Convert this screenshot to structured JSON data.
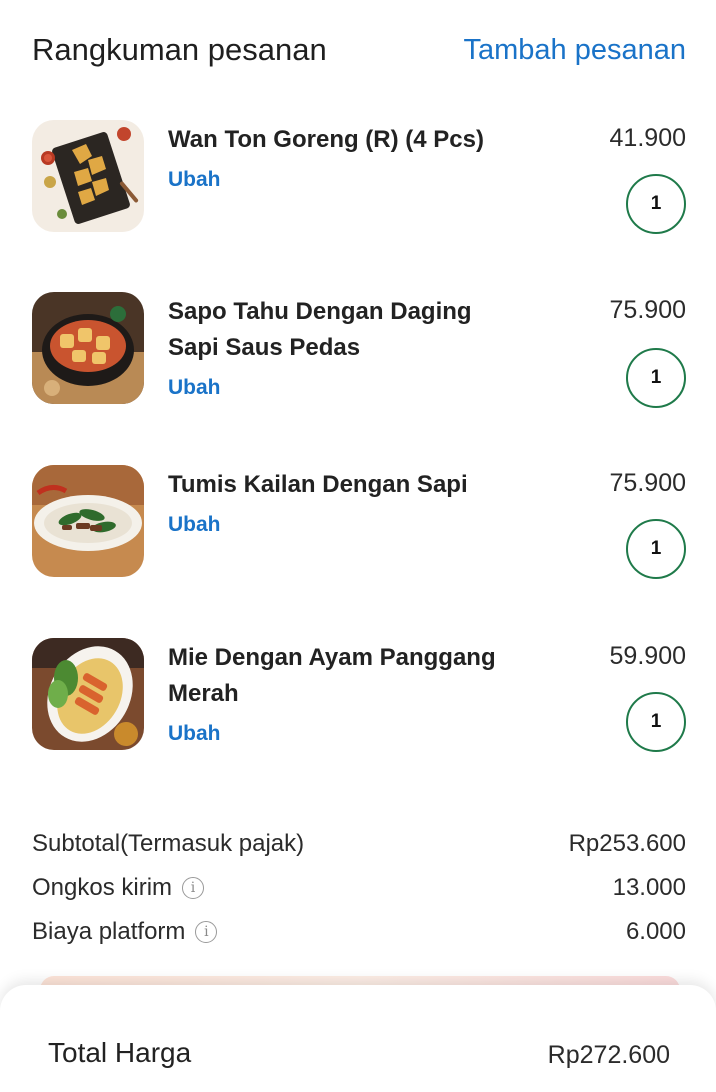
{
  "header": {
    "title": "Rangkuman pesanan",
    "add_label": "Tambah pesanan"
  },
  "items": [
    {
      "name": "Wan Ton Goreng (R) (4 Pcs)",
      "edit_label": "Ubah",
      "price": "41.900",
      "qty": "1",
      "image": "fried-wonton-image"
    },
    {
      "name": "Sapo Tahu Dengan Daging Sapi Saus Pedas",
      "edit_label": "Ubah",
      "price": "75.900",
      "qty": "1",
      "image": "tofu-claypot-image"
    },
    {
      "name": "Tumis Kailan Dengan Sapi",
      "edit_label": "Ubah",
      "price": "75.900",
      "qty": "1",
      "image": "stir-fry-kailan-image"
    },
    {
      "name": "Mie Dengan Ayam Panggang Merah",
      "edit_label": "Ubah",
      "price": "59.900",
      "qty": "1",
      "image": "noodle-roast-chicken-image"
    }
  ],
  "summary": {
    "subtotal_label": "Subtotal(Termasuk pajak)",
    "subtotal_value": "Rp253.600",
    "delivery_label": "Ongkos kirim",
    "delivery_value": "13.000",
    "platform_label": "Biaya platform",
    "platform_value": "6.000",
    "info_icon": "info-icon"
  },
  "footer": {
    "total_label": "Total Harga",
    "total_value": "Rp272.600"
  },
  "colors": {
    "accent": "#1a73c8",
    "qty_border": "#1f7a4a",
    "text": "#1f1f1f"
  }
}
